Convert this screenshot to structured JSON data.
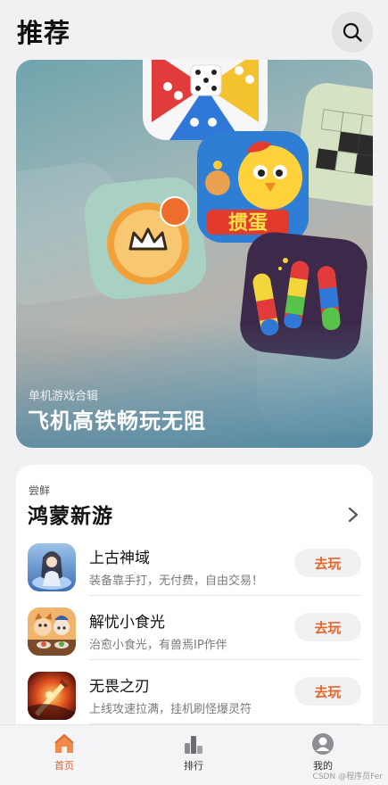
{
  "header": {
    "title": "推荐",
    "search_icon": "search-icon"
  },
  "banner": {
    "subtitle": "单机游戏合辑",
    "title": "飞机高铁畅玩无阻",
    "egg_art_text": "掼蛋"
  },
  "new_games": {
    "kicker": "尝鲜",
    "title": "鸿蒙新游",
    "more_icon": "chevron-right-icon",
    "items": [
      {
        "name": "上古神域",
        "desc": "装备靠手打，无付费，自由交易！",
        "action": "去玩"
      },
      {
        "name": "解忧小食光",
        "desc": "治愈小食光，有兽焉IP作伴",
        "action": "去玩"
      },
      {
        "name": "无畏之刃",
        "desc": "上线攻速拉满，挂机刷怪爆灵符",
        "action": "去玩"
      }
    ]
  },
  "bottom_nav": {
    "items": [
      {
        "label": "首页",
        "icon": "home-icon",
        "active": true
      },
      {
        "label": "排行",
        "icon": "ranking-icon",
        "active": false
      },
      {
        "label": "我的",
        "icon": "profile-icon",
        "active": false
      }
    ]
  },
  "watermark": "CSDN @程序员Fer",
  "colors": {
    "accent": "#e0662d",
    "background": "#f1f1f3"
  }
}
